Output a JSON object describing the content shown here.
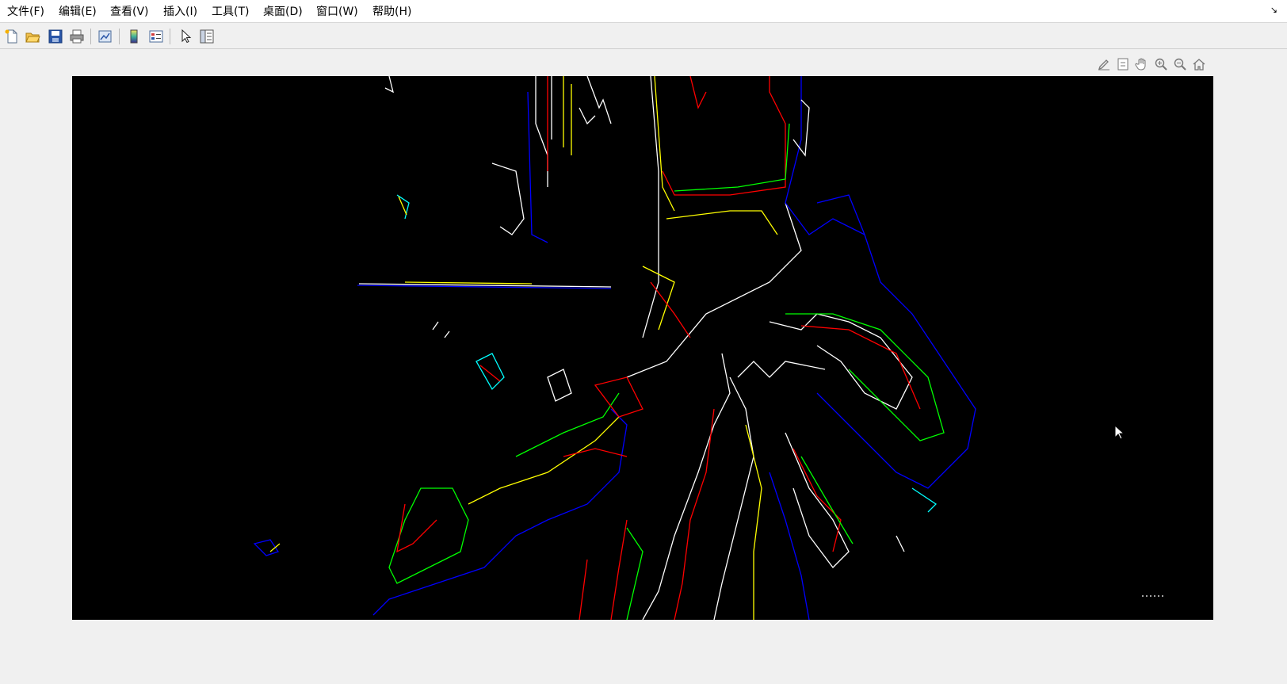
{
  "menu": {
    "items": [
      {
        "label": "文件(F)",
        "name": "menu-file"
      },
      {
        "label": "编辑(E)",
        "name": "menu-edit"
      },
      {
        "label": "查看(V)",
        "name": "menu-view"
      },
      {
        "label": "插入(I)",
        "name": "menu-insert"
      },
      {
        "label": "工具(T)",
        "name": "menu-tools"
      },
      {
        "label": "桌面(D)",
        "name": "menu-desktop"
      },
      {
        "label": "窗口(W)",
        "name": "menu-window"
      },
      {
        "label": "帮助(H)",
        "name": "menu-help"
      }
    ]
  },
  "toolbar": {
    "buttons": [
      {
        "icon": "new-file-icon"
      },
      {
        "icon": "open-folder-icon"
      },
      {
        "icon": "save-icon"
      },
      {
        "icon": "print-icon"
      },
      {
        "icon": "link-plot-icon"
      },
      {
        "icon": "colorbar-icon"
      },
      {
        "icon": "legend-icon"
      },
      {
        "icon": "edit-plot-arrow-icon"
      },
      {
        "icon": "property-inspector-icon"
      }
    ]
  },
  "axes_toolbar": {
    "buttons": [
      {
        "icon": "brush-icon"
      },
      {
        "icon": "datatip-icon"
      },
      {
        "icon": "pan-hand-icon"
      },
      {
        "icon": "zoom-in-icon"
      },
      {
        "icon": "zoom-out-icon"
      },
      {
        "icon": "home-icon"
      }
    ]
  },
  "colors": {
    "edge_white": "#ffffff",
    "edge_red": "#ff0000",
    "edge_green": "#00ff00",
    "edge_blue": "#0000ff",
    "edge_yellow": "#ffff00",
    "edge_cyan": "#00ffff",
    "background": "#000000"
  }
}
